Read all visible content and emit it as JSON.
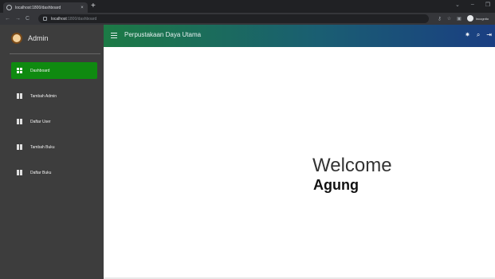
{
  "browser": {
    "tab_title": "localhost:1800/dashboard",
    "tab_close": "×",
    "new_tab": "+",
    "url_host": "localhost",
    "url_path": ":1800/dashboard",
    "incognito_label": "Incognito",
    "window_controls": [
      "⌄",
      "–",
      "❐"
    ],
    "nav": [
      "←",
      "→",
      "C"
    ]
  },
  "sidebar": {
    "brand": "Admin",
    "items": [
      {
        "label": "Dashboard",
        "icon": "dashboard-icon",
        "active": true
      },
      {
        "label": "Tambah Admin",
        "icon": "book-icon",
        "active": false
      },
      {
        "label": "Daftar User",
        "icon": "book-icon",
        "active": false
      },
      {
        "label": "Tambah Buku",
        "icon": "book-icon",
        "active": false
      },
      {
        "label": "Daftar Buku",
        "icon": "book-icon",
        "active": false
      }
    ]
  },
  "header": {
    "title": "Perpustakaan Daya Utama",
    "icons": [
      "✷",
      "🔍",
      "⇥"
    ]
  },
  "main": {
    "welcome": "Welcome",
    "user": "Agung"
  },
  "colors": {
    "sidebar_bg": "#3d3d3d",
    "active_item": "#0f8a10",
    "header_gradient_start": "#1c7a45",
    "header_gradient_end": "#1a3e82"
  }
}
